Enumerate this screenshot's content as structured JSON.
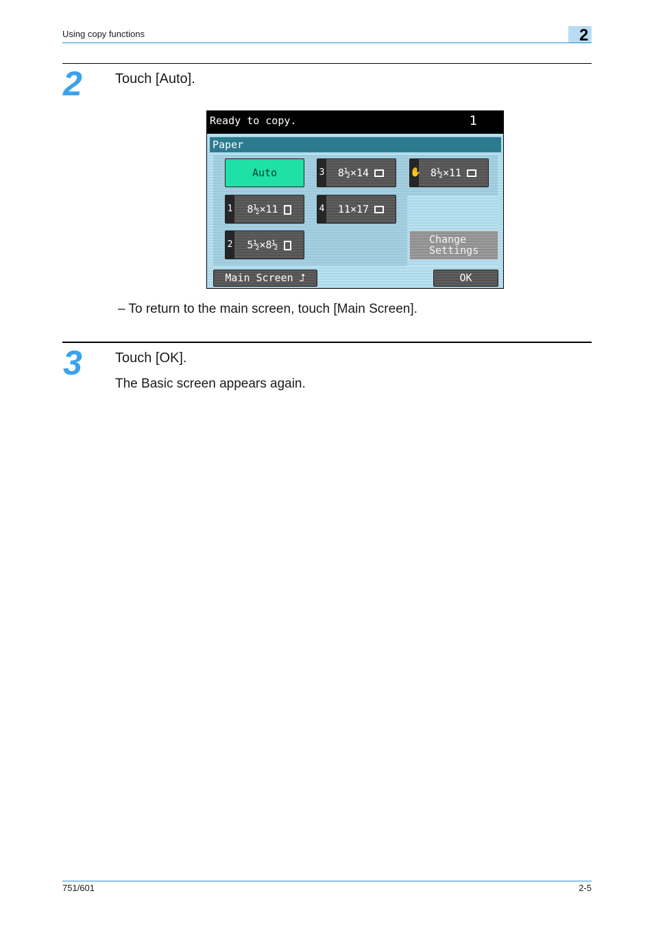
{
  "header": {
    "section_title": "Using copy functions",
    "chapter_number": "2"
  },
  "steps": [
    {
      "number": "2",
      "instruction": "Touch [Auto].",
      "note": "–  To return to the main screen, touch [Main Screen]."
    },
    {
      "number": "3",
      "instruction": "Touch [OK].",
      "result": "The Basic screen appears again."
    }
  ],
  "device_screen": {
    "status_message": "Ready to copy.",
    "copy_count": "1",
    "section_title": "Paper",
    "paper_buttons": [
      {
        "tray": "",
        "label": "Auto",
        "orientation": "",
        "selected": true
      },
      {
        "tray": "3",
        "label": "8½×14",
        "orientation": "landscape-paper-icon",
        "selected": false
      },
      {
        "tray": "hand-icon",
        "label": "8½×11",
        "orientation": "landscape-paper-icon",
        "selected": false
      },
      {
        "tray": "1",
        "label": "8½×11",
        "orientation": "portrait-paper-icon",
        "selected": false
      },
      {
        "tray": "4",
        "label": "11×17",
        "orientation": "landscape-paper-icon",
        "selected": false
      },
      {
        "tray": "2",
        "label": "5½×8½",
        "orientation": "portrait-paper-icon",
        "selected": false
      }
    ],
    "change_settings_line1": "Change",
    "change_settings_line2": "Settings",
    "main_screen_label": "Main Screen",
    "ok_label": "OK",
    "colors": {
      "selected": "#1fe0a6",
      "title_bar": "#2c7a8e"
    }
  },
  "footer": {
    "model": "751/601",
    "page": "2-5"
  }
}
